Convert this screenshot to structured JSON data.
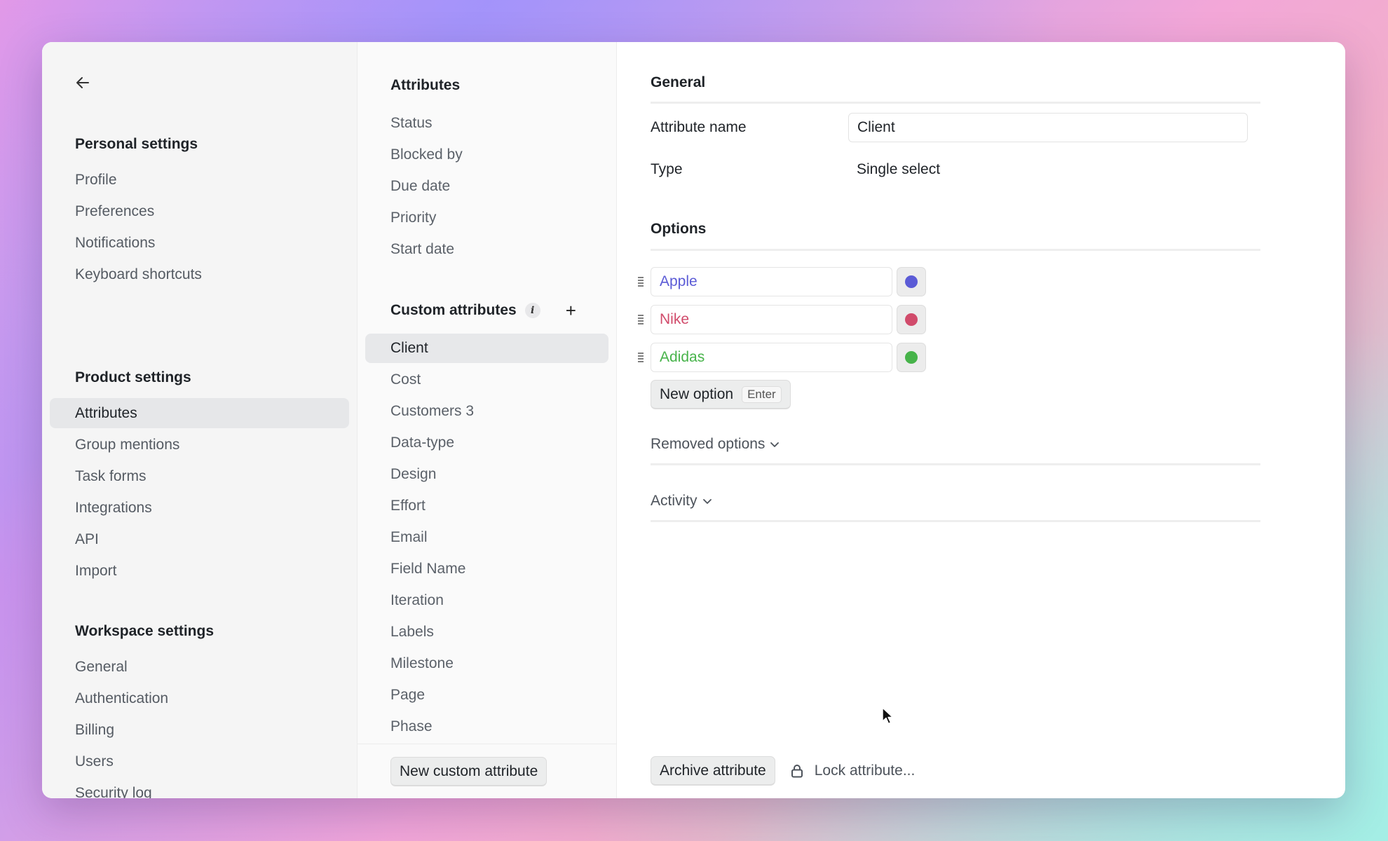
{
  "personal_settings": {
    "heading": "Personal settings",
    "items": [
      "Profile",
      "Preferences",
      "Notifications",
      "Keyboard shortcuts"
    ]
  },
  "product_settings": {
    "heading": "Product settings",
    "items": [
      "Attributes",
      "Group mentions",
      "Task forms",
      "Integrations",
      "API",
      "Import"
    ],
    "active": "Attributes"
  },
  "workspace_settings": {
    "heading": "Workspace settings",
    "items": [
      "General",
      "Authentication",
      "Billing",
      "Users",
      "Security log"
    ]
  },
  "attributes": {
    "heading": "Attributes",
    "items": [
      "Status",
      "Blocked by",
      "Due date",
      "Priority",
      "Start date"
    ]
  },
  "custom_attributes": {
    "heading": "Custom attributes",
    "items": [
      "Client",
      "Cost",
      "Customers 3",
      "Data-type",
      "Design",
      "Effort",
      "Email",
      "Field Name",
      "Iteration",
      "Labels",
      "Milestone",
      "Page",
      "Phase"
    ],
    "active": "Client",
    "new_button": "New custom attribute"
  },
  "general": {
    "title": "General",
    "name_label": "Attribute name",
    "name_value": "Client",
    "type_label": "Type",
    "type_value": "Single select"
  },
  "options": {
    "title": "Options",
    "items": [
      {
        "label": "Apple",
        "color": "#5b5bd6"
      },
      {
        "label": "Nike",
        "color": "#d14b6b"
      },
      {
        "label": "Adidas",
        "color": "#47b34a"
      }
    ],
    "new_option_label": "New option",
    "new_option_shortcut": "Enter"
  },
  "removed_options": "Removed options",
  "activity": "Activity",
  "footer": {
    "archive": "Archive attribute",
    "lock": "Lock attribute..."
  }
}
